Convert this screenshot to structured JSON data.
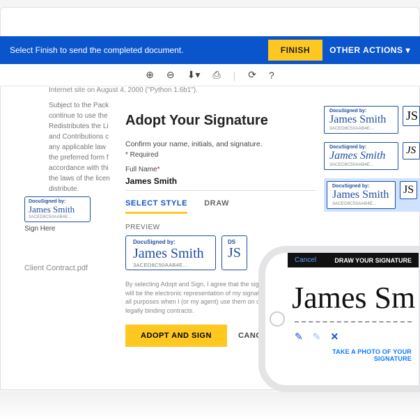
{
  "topbar": {
    "message": "Select Finish to send the completed document.",
    "finish_label": "FINISH",
    "other_label": "OTHER ACTIONS"
  },
  "doc": {
    "header": "Internet site on August 4, 2000 (\"Python 1.6b1\").",
    "body": "Subject to the Pack\ncontinue to use the\nRedistributes the Li\nand Contributions c\nany applicable law\nthe preferred form f\naccordance with thi\nthe laws of the licen\ndistribute.",
    "filename": "Client Contract.pdf"
  },
  "mini_sig": {
    "ds": "DocuSigned by:",
    "name": "James Smith",
    "hash": "3ACED8C50AAB4E...",
    "under": "Sign Here"
  },
  "modal": {
    "title": "Adopt Your Signature",
    "sub": "Confirm your name, initials, and signature.",
    "required": "* Required",
    "fullname_label": "Full Name",
    "fullname_value": "James Smith",
    "tab_select": "SELECT STYLE",
    "tab_draw": "DRAW",
    "preview_label": "PREVIEW",
    "preview_sig": {
      "ds": "DocuSigned by:",
      "name": "James Smith",
      "hash": "3ACED8C50AAB4E..."
    },
    "preview_init": {
      "ds": "DS",
      "ini": "JS"
    },
    "disclaimer": "By selecting Adopt and Sign, I agree that the signature and initials will be the electronic representation of my signature and initials for all purposes when I (or my agent) use them on documents, including legally binding contracts.",
    "adopt_label": "ADOPT AND SIGN",
    "cancel_label": "CANCEL"
  },
  "styles": {
    "ds": "DocuSigned by:",
    "hash": "3ACED8C50AAB4E...",
    "opts": [
      {
        "name": "James Smith",
        "init": "JS"
      },
      {
        "name": "James Smith",
        "init": "JS"
      },
      {
        "name": "James Smith",
        "init": "JS"
      }
    ]
  },
  "phone": {
    "cancel": "Cancel",
    "title": "DRAW YOUR SIGNATURE",
    "signed": "James Sm",
    "link": "TAKE A PHOTO OF YOUR SIGNATURE"
  }
}
